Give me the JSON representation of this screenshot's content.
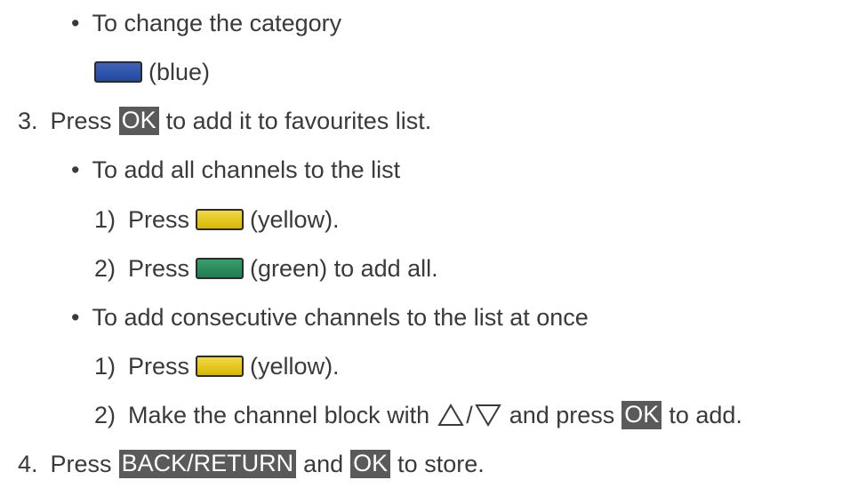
{
  "items": {
    "b1": {
      "bullet": "•",
      "text": "To change the category"
    },
    "b1_sub": {
      "color": "(blue)"
    },
    "s3": {
      "num": "3.",
      "pre": "Press",
      "key": "OK",
      "post": "to add it to favourites list."
    },
    "b2": {
      "bullet": "•",
      "text": "To add all channels to the list"
    },
    "b2_1": {
      "num": "1)",
      "pre": "Press",
      "post": "(yellow)."
    },
    "b2_2": {
      "num": "2)",
      "pre": "Press",
      "post": "(green) to add all."
    },
    "b3": {
      "bullet": "•",
      "text": "To add consecutive channels to the list at once"
    },
    "b3_1": {
      "num": "1)",
      "pre": "Press",
      "post": "(yellow)."
    },
    "b3_2": {
      "num": "2)",
      "pre": "Make the channel block with",
      "sep": "/",
      "mid": "and press",
      "key": "OK",
      "post": "to add."
    },
    "s4": {
      "num": "4.",
      "pre": "Press",
      "key1": "BACK/RETURN",
      "mid": "and",
      "key2": "OK",
      "post": "to store."
    }
  },
  "colors": {
    "blue": "#2f56ad",
    "yellow": "#e6c81c",
    "green": "#2a8b5c",
    "key_bg": "#5a5a5a",
    "text": "#3a3a3a"
  },
  "icons": [
    "blue-button-icon",
    "yellow-button-icon",
    "green-button-icon",
    "up-triangle-icon",
    "down-triangle-icon"
  ]
}
